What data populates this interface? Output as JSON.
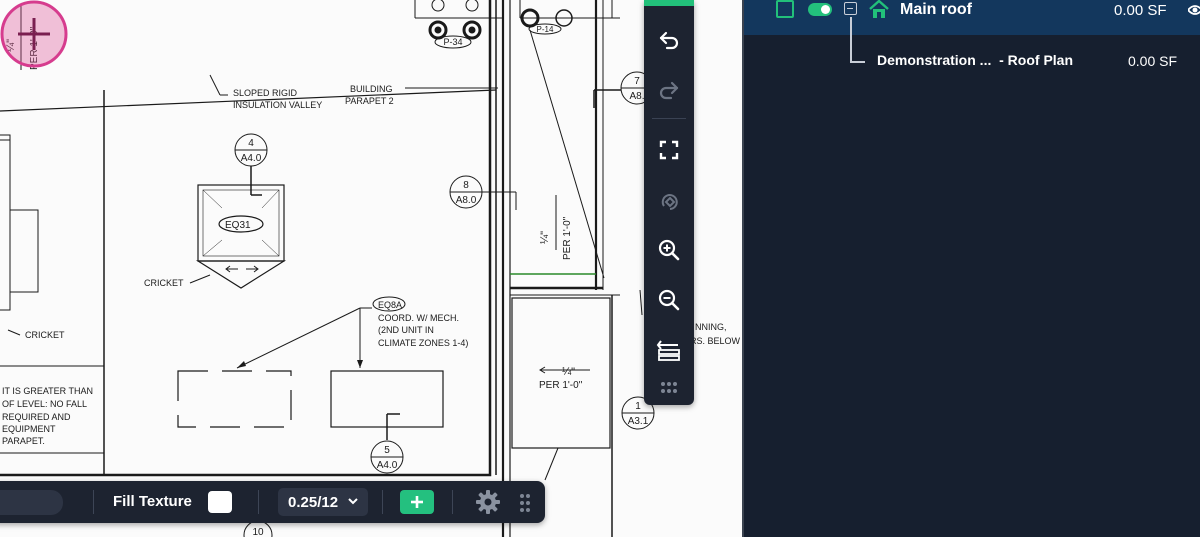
{
  "drawing": {
    "labels": {
      "sloped_insulation": [
        "SLOPED RIGID",
        "INSULATION VALLEY"
      ],
      "building_parapet": [
        "BUILDING",
        "PARAPET 2"
      ],
      "cricket_a": "CRICKET",
      "cricket_b": "CRICKET",
      "eq_tag": "EQ31",
      "eq_note": [
        "EQ8A",
        "COORD. W/ MECH.",
        "(2ND UNIT IN",
        "CLIMATE ZONES 1-4)"
      ],
      "left_note": [
        "IT IS GREATER THAN",
        "OF LEVEL: NO FALL",
        "REQUIRED AND",
        "EQUIPMENT",
        "PARAPET."
      ],
      "right_note": [
        "NNING,",
        "RS. BELOW"
      ],
      "slope_left": [
        "¼\"",
        "PER 1'-0\""
      ],
      "slope_mid": [
        "¼\"",
        "PER 1'-0\""
      ],
      "slope_right": [
        "¼\"",
        "PER 1'-0\""
      ],
      "p_tag_a": "P-34",
      "p_tag_b": "P-14"
    },
    "callouts": [
      {
        "num": "4",
        "sheet": "A4.0"
      },
      {
        "num": "8",
        "sheet": "A8.0"
      },
      {
        "num": "7",
        "sheet": "A8."
      },
      {
        "num": "5",
        "sheet": "A4.0"
      },
      {
        "num": "1",
        "sheet": "A3.1"
      },
      {
        "num": "10",
        "sheet": ""
      }
    ]
  },
  "vertical_toolbar": {
    "buttons": [
      {
        "name": "undo-icon",
        "enabled": true
      },
      {
        "name": "redo-icon",
        "enabled": false
      },
      {
        "name": "fit-screen-icon",
        "enabled": true
      },
      {
        "name": "rotate-icon",
        "enabled": false
      },
      {
        "name": "zoom-in-icon",
        "enabled": true
      },
      {
        "name": "zoom-out-icon",
        "enabled": true
      },
      {
        "name": "layers-icon",
        "enabled": true
      },
      {
        "name": "drag-handle-icon",
        "enabled": true
      }
    ]
  },
  "bottom_toolbar": {
    "fill_texture_label": "Fill Texture",
    "fill_color": "#ffffff",
    "scale_value": "0.25/12"
  },
  "layers_panel": {
    "main": {
      "name": "Main roof",
      "value": "0.00 SF",
      "visible": true,
      "enabled": true
    },
    "child": {
      "name": "Demonstration ...  - Roof Plan",
      "value": "0.00 SF"
    }
  },
  "colors": {
    "accent": "#22c07a",
    "panel_bg": "#161f2f",
    "selected_row": "#13375d",
    "toolbar_bg": "#1d2330",
    "cursor": "#d63c8e"
  }
}
